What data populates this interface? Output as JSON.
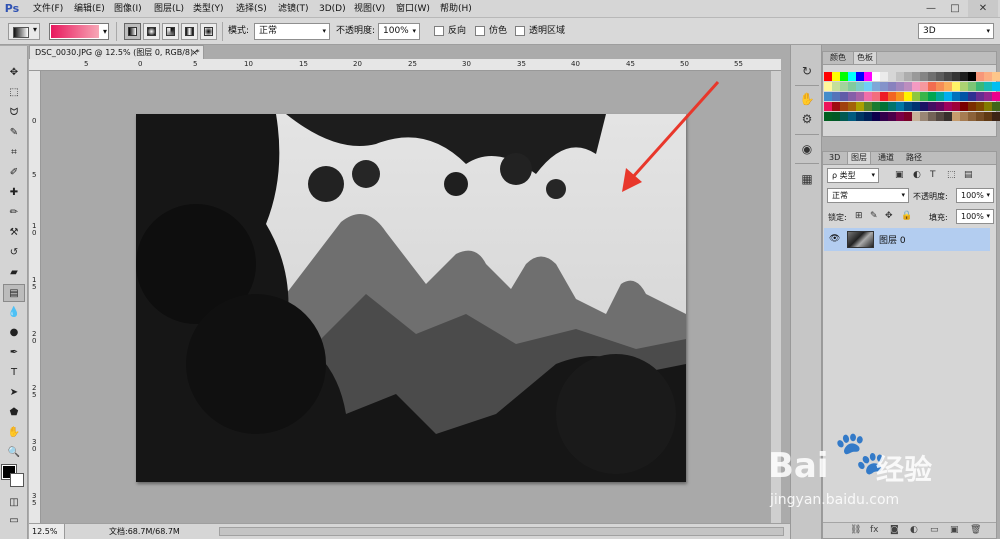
{
  "app": {
    "logo": "Ps",
    "menu": [
      "文件(F)",
      "编辑(E)",
      "图像(I)",
      "图层(L)",
      "类型(Y)",
      "选择(S)",
      "滤镜(T)",
      "3D(D)",
      "视图(V)",
      "窗口(W)",
      "帮助(H)"
    ],
    "window_controls": [
      "—",
      "□",
      "✕"
    ]
  },
  "options_bar": {
    "mode_label": "模式:",
    "mode_value": "正常",
    "opacity_label": "不透明度:",
    "opacity_value": "100%",
    "reverse_label": "反向",
    "dither_label": "仿色",
    "transparency_label": "透明区域",
    "gradient_colors": [
      "#e8175d",
      "#f7a7b6"
    ]
  },
  "workspace": {
    "value": "3D"
  },
  "document": {
    "tab_title": "DSC_0030.JPG @ 12.5% (图层 0, RGB/8) *",
    "close": "×",
    "ruler_h": [
      "5",
      "0",
      "5",
      "10",
      "15",
      "20",
      "25",
      "30",
      "35",
      "40",
      "45",
      "50",
      "55"
    ],
    "ruler_v": [
      "0",
      "5",
      "1\n0",
      "1\n5",
      "2\n0",
      "2\n5",
      "3\n0",
      "3\n5"
    ],
    "zoom": "12.5%",
    "doc_info": "文档:68.7M/68.7M"
  },
  "tools": [
    "move-tool",
    "marquee-tool",
    "lasso-tool",
    "quick-select-tool",
    "crop-tool",
    "eyedropper-tool",
    "spot-healing-tool",
    "brush-tool",
    "clone-stamp-tool",
    "history-brush-tool",
    "eraser-tool",
    "gradient-tool",
    "blur-tool",
    "dodge-tool",
    "pen-tool",
    "type-tool",
    "path-select-tool",
    "shape-tool",
    "hand-tool",
    "zoom-tool"
  ],
  "tool_glyphs": [
    "✥",
    "⬚",
    "ᗢ",
    "✎",
    "⌗",
    "✐",
    "✚",
    "✏",
    "⚒",
    "↺",
    "▰",
    "▤",
    "💧",
    "●",
    "✒",
    "T",
    "➤",
    "⬟",
    "✋",
    "🔍"
  ],
  "swatches_panel": {
    "tabs": [
      "颜色",
      "色板"
    ],
    "colors": [
      [
        "#ff0000",
        "#ffff00",
        "#00ff00",
        "#00ffff",
        "#0000ff",
        "#ff00ff",
        "#ffffff",
        "#ebebeb",
        "#d6d6d6",
        "#c2c2c2",
        "#adadad",
        "#999999",
        "#858585",
        "#707070",
        "#5c5c5c",
        "#474747",
        "#333333",
        "#1f1f1f",
        "#000000",
        "#f7977a",
        "#fbad82",
        "#fdc68a"
      ],
      [
        "#fff79a",
        "#c4df9b",
        "#a3d39c",
        "#82ca9d",
        "#7bcdc8",
        "#6ecff6",
        "#7ea7d8",
        "#8493ca",
        "#8882be",
        "#a187be",
        "#bc8dbf",
        "#f49ac2",
        "#f6989d",
        "#f26c4f",
        "#f68e55",
        "#fbaf5c",
        "#fff467",
        "#acd372",
        "#7cc576",
        "#3bb878",
        "#1abbb4",
        "#00bff3"
      ],
      [
        "#438cca",
        "#5574b9",
        "#605ca8",
        "#855fa8",
        "#a763a8",
        "#f06ea9",
        "#f26d7d",
        "#ed1c24",
        "#f26522",
        "#f7941d",
        "#fff200",
        "#8dc73f",
        "#39b54a",
        "#00a651",
        "#00a99d",
        "#00aeef",
        "#0072bc",
        "#0054a6",
        "#2e3192",
        "#662d91",
        "#92278f",
        "#ec008c"
      ],
      [
        "#ed145b",
        "#9e0b0f",
        "#a0410d",
        "#a36209",
        "#aba000",
        "#598527",
        "#1a7b30",
        "#007236",
        "#00746b",
        "#0076a3",
        "#004b80",
        "#003471",
        "#1b1464",
        "#440e62",
        "#630460",
        "#9e005d",
        "#9e0039",
        "#790000",
        "#7b2e00",
        "#7d4900",
        "#827b00",
        "#406618"
      ],
      [
        "#005e20",
        "#005826",
        "#005952",
        "#005b7f",
        "#003663",
        "#002157",
        "#0d004c",
        "#32004b",
        "#4b0049",
        "#7b0046",
        "#7a0026",
        "#c7b299",
        "#998675",
        "#736357",
        "#534741",
        "#37302d",
        "#c69c6d",
        "#a67c52",
        "#8c6239",
        "#754c24",
        "#603913",
        "#3c2415"
      ]
    ]
  },
  "layers_panel": {
    "tabs": [
      "3D",
      "图层",
      "通道",
      "路径"
    ],
    "filter_label": "ρ 类型",
    "blend_mode": "正常",
    "opacity_label": "不透明度:",
    "opacity_value": "100%",
    "lock_label": "锁定:",
    "fill_label": "填充:",
    "fill_value": "100%",
    "layer_name": "图层 0",
    "footer_icons": [
      "link-icon",
      "fx-icon",
      "mask-icon",
      "adjustment-icon",
      "group-icon",
      "new-layer-icon",
      "trash-icon"
    ],
    "footer_glyphs": [
      "⛓",
      "fx",
      "◙",
      "◐",
      "▭",
      "▣",
      "🗑"
    ]
  },
  "watermark": {
    "brand": "Bai",
    "brand_tail": "经验",
    "domain": "jingyan.baidu.com"
  },
  "arrow_color": "#e8372b"
}
